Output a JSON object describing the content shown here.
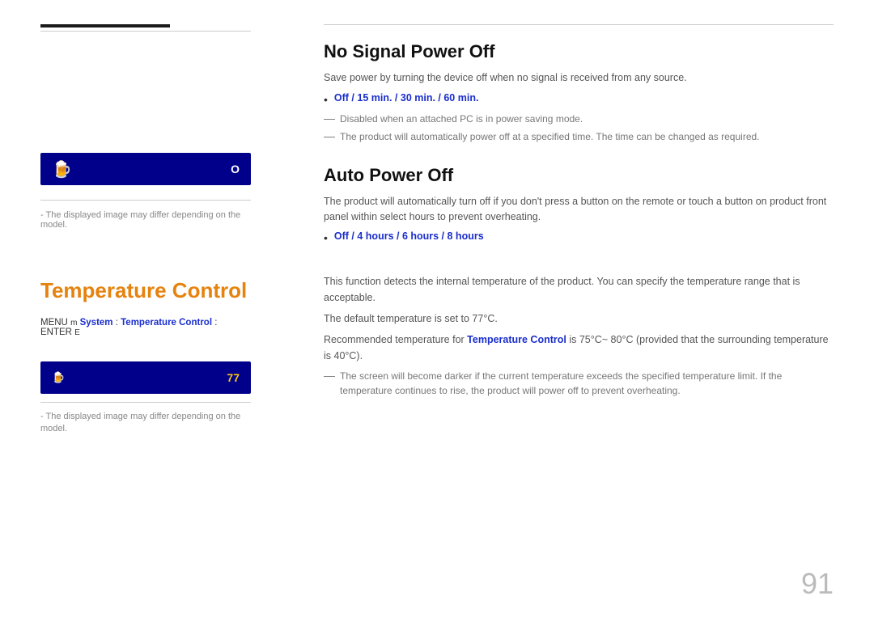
{
  "left": {
    "top_bar_present": true,
    "screen1": {
      "icon": "🍺",
      "value": "O"
    },
    "note1": "- The displayed image may differ depending on the model.",
    "temp_title": "Temperature Control",
    "menu_path_prefix": "MENU ",
    "menu_m": "m",
    "menu_system_label": "System",
    "menu_colon": "  :  ",
    "menu_temp_label": "Temperature Control",
    "menu_enter_prefix": "  :  ENTER ",
    "menu_e": "E",
    "screen2": {
      "icon": "🍺",
      "value": "77"
    },
    "note2": "- The displayed image may differ depending on the model."
  },
  "right": {
    "no_signal": {
      "title": "No Signal Power Off",
      "desc": "Save power by turning the device off when no signal is received from any source.",
      "bullet": "Off / 15 min. / 30 min. / 60 min.",
      "dash1": "Disabled when an attached PC is in power saving mode.",
      "dash2": "The product will automatically power off at a specified time. The time can be changed as required."
    },
    "auto_power": {
      "title": "Auto Power Off",
      "desc": "The product will automatically turn off if you don't press a button on the remote or touch a button on product front panel within select hours to prevent overheating.",
      "bullet": "Off / 4 hours / 6 hours / 8 hours"
    },
    "temp_control": {
      "desc1": "This function detects the internal temperature of the product. You can specify the temperature range that is acceptable.",
      "desc2": "The default temperature is set to 77°C.",
      "desc3_prefix": "Recommended temperature for ",
      "desc3_highlight": "Temperature Control",
      "desc3_suffix": " is 75°C~ 80°C (provided that the surrounding temperature is 40°C).",
      "dash": "The screen will become darker if the current temperature exceeds the specified temperature limit. If the temperature continues to rise, the product will power off to prevent overheating."
    }
  },
  "page_number": "91"
}
